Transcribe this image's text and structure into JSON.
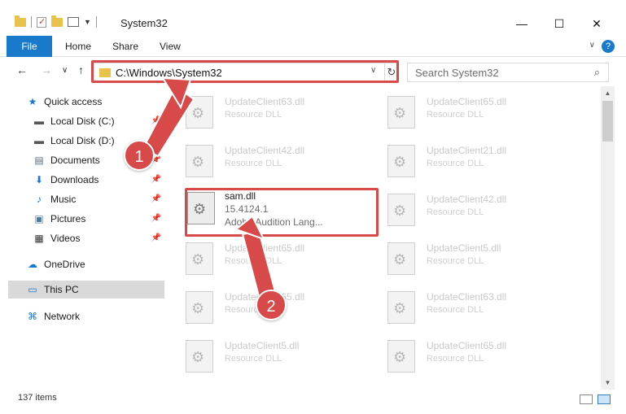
{
  "window": {
    "title": "System32",
    "minimize": "—",
    "maximize": "☐",
    "close": "✕"
  },
  "ribbon": {
    "tabs": [
      "File",
      "Home",
      "Share",
      "View"
    ],
    "help": "?",
    "expand": "∨"
  },
  "nav": {
    "back": "←",
    "forward": "→",
    "recent": "∨",
    "up": "↑",
    "address": "C:\\Windows\\System32",
    "address_dropdown": "∨",
    "refresh": "↻",
    "search_placeholder": "Search System32",
    "search_icon": "⌕"
  },
  "sidebar": {
    "items": [
      {
        "label": "Quick access",
        "icon": "star-icon",
        "glyph": "★",
        "pinned": false,
        "color": "#1979ca"
      },
      {
        "label": "Local Disk (C:)",
        "icon": "drive-icon",
        "glyph": "▬",
        "pinned": true,
        "color": "#555555"
      },
      {
        "label": "Local Disk (D:)",
        "icon": "drive-icon",
        "glyph": "▬",
        "pinned": true,
        "color": "#555555"
      },
      {
        "label": "Documents",
        "icon": "documents-icon",
        "glyph": "▤",
        "pinned": true,
        "color": "#5a6b7c"
      },
      {
        "label": "Downloads",
        "icon": "download-icon",
        "glyph": "⬇",
        "pinned": true,
        "color": "#1979ca"
      },
      {
        "label": "Music",
        "icon": "music-icon",
        "glyph": "♪",
        "pinned": true,
        "color": "#1979ca"
      },
      {
        "label": "Pictures",
        "icon": "pictures-icon",
        "glyph": "▣",
        "pinned": true,
        "color": "#4a7aa6"
      },
      {
        "label": "Videos",
        "icon": "video-icon",
        "glyph": "▦",
        "pinned": true,
        "color": "#333333"
      },
      {
        "label": "OneDrive",
        "icon": "cloud-icon",
        "glyph": "☁",
        "pinned": false,
        "color": "#1979ca"
      },
      {
        "label": "This PC",
        "icon": "computer-icon",
        "glyph": "▭",
        "pinned": false,
        "color": "#1979ca"
      },
      {
        "label": "Network",
        "icon": "network-icon",
        "glyph": "⌘",
        "pinned": false,
        "color": "#1979ca"
      }
    ],
    "pin_glyph": "📌"
  },
  "files": {
    "col1": [
      {
        "name": "UpdateClient63.dll",
        "desc": "Resource DLL"
      },
      {
        "name": "UpdateClient42.dll",
        "desc": "Resource DLL"
      },
      {
        "name": "sam.dll",
        "version": "15.4124.1",
        "desc": "Adobe Audition Lang...",
        "active": true
      },
      {
        "name": "UpdateClient65.dll",
        "desc": "Resource DLL"
      },
      {
        "name": "UpdateClient65.dll",
        "desc": "Resource DLL"
      },
      {
        "name": "UpdateClient5.dll",
        "desc": "Resource DLL"
      }
    ],
    "col2": [
      {
        "name": "UpdateClient65.dll",
        "desc": "Resource DLL"
      },
      {
        "name": "UpdateClient21.dll",
        "desc": "Resource DLL"
      },
      {
        "name": "UpdateClient42.dll",
        "desc": "Resource DLL"
      },
      {
        "name": "UpdateClient5.dll",
        "desc": "Resource DLL"
      },
      {
        "name": "UpdateClient63.dll",
        "desc": "Resource DLL"
      },
      {
        "name": "UpdateClient65.dll",
        "desc": "Resource DLL"
      }
    ]
  },
  "status": {
    "count": "137 items"
  },
  "callouts": {
    "step1": "1",
    "step2": "2",
    "color": "#d84a4a"
  }
}
